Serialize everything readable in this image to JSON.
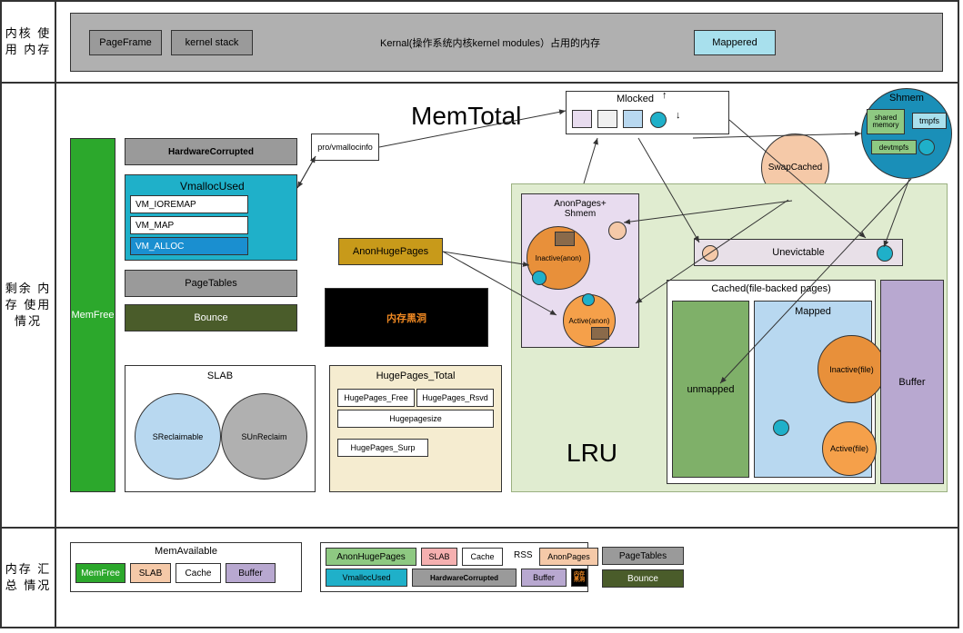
{
  "section1": {
    "title": "内核\n使用\n内存"
  },
  "section2": {
    "title": "剩余\n内存\n使用\n情况"
  },
  "section3": {
    "title": "内存\n汇总\n情况"
  },
  "kernel": {
    "title": "Kernal(操作系统内核kernel modules）占用的内存",
    "pageFrame": "PageFrame",
    "kernelStack": "kernel stack",
    "mappered": "Mappered"
  },
  "memTotal": "MemTotal",
  "memFree": "MemFree",
  "hardwareCorrupted": "HardwareCorrupted",
  "vmalloc": {
    "used": "VmallocUsed",
    "ioremap": "VM_IOREMAP",
    "map": "VM_MAP",
    "alloc": "VM_ALLOC"
  },
  "proVm": "pro/vmallocinfo",
  "pageTables": "PageTables",
  "bounce": "Bounce",
  "blackhole": "内存黑洞",
  "anonHuge": "AnonHugePages",
  "mlocked": "Mlocked",
  "swapCached": "SwapCached",
  "shmem": {
    "title": "Shmem",
    "shared": "shared memory",
    "tmpfs": "tmpfs",
    "devtmpfs": "devtmpfs"
  },
  "anonPagesShmem": "AnonPages+\nShmem",
  "inactiveAnon": "Inactive(anon)",
  "activeAnon": "Active(anon)",
  "unevictable": "Unevictable",
  "lru": "LRU",
  "cached": {
    "title": "Cached(file-backed pages)",
    "unmapped": "unmapped",
    "mapped": "Mapped",
    "inactiveFile": "Inactive(file)",
    "activeFile": "Active(file)"
  },
  "buffer": "Buffer",
  "slab": {
    "title": "SLAB",
    "sRec": "SReclaimable",
    "sUnRec": "SUnReclaim"
  },
  "hugePages": {
    "title": "HugePages_Total",
    "free": "HugePages_Free",
    "rsvd": "HugePages_Rsvd",
    "size": "Hugepagesize",
    "surp": "HugePages_Surp"
  },
  "summary": {
    "memAvail": "MemAvailable",
    "memFree": "MemFree",
    "slab": "SLAB",
    "cache": "Cache",
    "buffer": "Buffer",
    "rss": "RSS",
    "anonHuge": "AnonHugePages",
    "vmalloc": "VmallocUsed",
    "hwCorr": "HardwareCorrupted",
    "anonPages": "AnonPages",
    "blackhole": "内存黑洞",
    "pageTables": "PageTables",
    "bounce": "Bounce"
  }
}
